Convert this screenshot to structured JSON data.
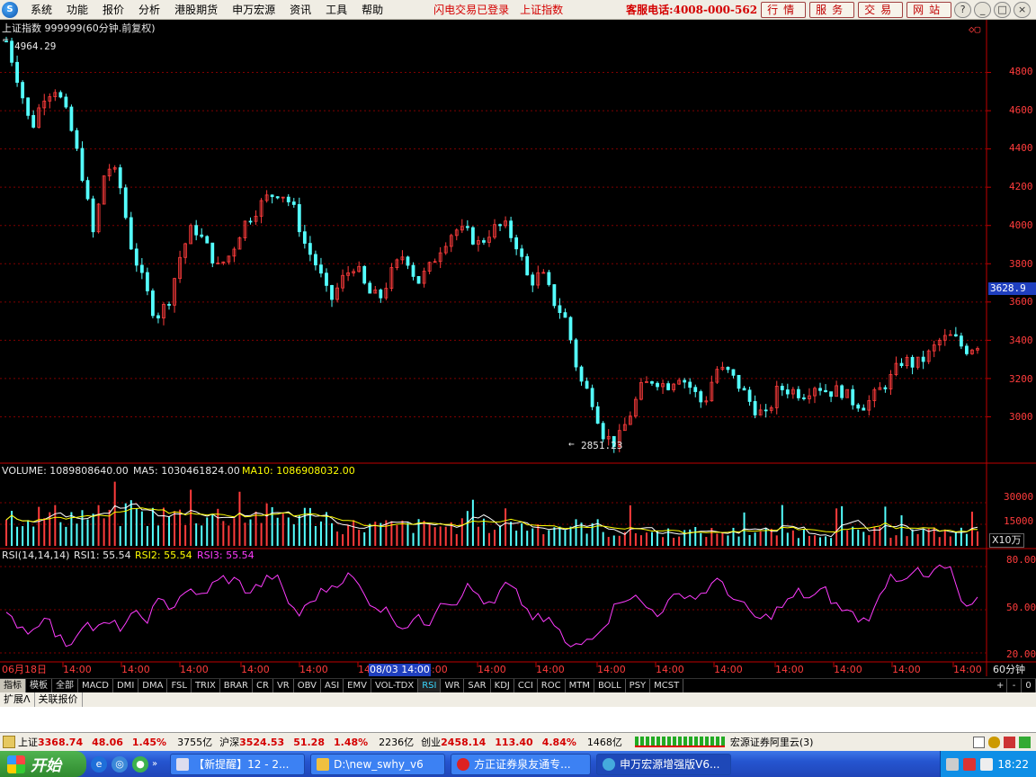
{
  "menu": {
    "app_icon": "globe-icon",
    "items": [
      "系统",
      "功能",
      "报价",
      "分析",
      "港股期货",
      "申万宏源",
      "资讯",
      "工具",
      "帮助"
    ],
    "flash_status": "闪电交易已登录",
    "index_name": "上证指数",
    "hotline": "客服电话:4008-000-562",
    "right_buttons": [
      "行情",
      "服务",
      "交易",
      "网站"
    ],
    "window_controls": [
      "?",
      "_",
      "□",
      "×"
    ]
  },
  "chart": {
    "header": "上证指数 999999(60分钟.前复权)",
    "high_label": "4964.29",
    "low_label": "2851.23",
    "current_price": "3628.9",
    "y_ticks": [
      "4800",
      "4600",
      "4400",
      "4200",
      "4000",
      "3800",
      "3600",
      "3400",
      "3200",
      "3000"
    ],
    "volume_header": {
      "volume": "VOLUME: 1089808640.00",
      "ma5": "MA5: 1030461824.00",
      "ma10": "MA10: 1086908032.00"
    },
    "volume_ticks": [
      "30000",
      "15000"
    ],
    "volume_unit": "X10万",
    "rsi_header": {
      "name": "RSI(14,14,14)",
      "rsi1": "RSI1: 55.54",
      "rsi2": "RSI2: 55.54",
      "rsi3": "RSI3: 55.54"
    },
    "rsi_ticks": [
      "80.00",
      "50.00",
      "20.00"
    ],
    "time_labels": [
      "06月18日",
      "14:00",
      "14:00",
      "14:00",
      "14:00",
      "14:00",
      "14:00",
      "14:00",
      "14:00",
      "14:00",
      "14:00",
      "14:00",
      "14:00",
      "14:00",
      "14:00",
      "14:00",
      "14:00"
    ],
    "cursor_label": "08/03 14:00",
    "period": "60分钟",
    "colors": {
      "up": "#ff3c3c",
      "down": "#54ffff",
      "ma5": "#ffffff",
      "ma10": "#ffff00",
      "rsi": "#ff3cff",
      "grid": "#800000",
      "axis": "#c00000"
    }
  },
  "chart_data": {
    "type": "candlestick",
    "title": "上证指数 999999(60分钟.前复权)",
    "ylim": [
      2800,
      5000
    ],
    "high": 4964.29,
    "low": 2851.23,
    "current": 3628.9,
    "price_path": [
      4964,
      4750,
      4500,
      4680,
      4720,
      4550,
      4300,
      3950,
      4320,
      4250,
      3900,
      3700,
      3520,
      3600,
      3850,
      4000,
      3900,
      3780,
      3850,
      4000,
      4080,
      4150,
      4180,
      4100,
      3900,
      3780,
      3600,
      3720,
      3800,
      3650,
      3620,
      3760,
      3860,
      3700,
      3780,
      3900,
      3980,
      3960,
      3900,
      3980,
      4000,
      3900,
      3700,
      3750,
      3600,
      3500,
      3200,
      3100,
      2900,
      2860,
      3000,
      3150,
      3200,
      3160,
      3220,
      3150,
      3060,
      3250,
      3230,
      3150,
      3050,
      3000,
      3150,
      3140,
      3120,
      3170,
      3130,
      3140,
      3080,
      3060,
      3130,
      3200,
      3300,
      3270,
      3320,
      3400,
      3420,
      3350,
      3380
    ],
    "volume_ylim": [
      0,
      40000
    ],
    "volume_ticks": [
      30000,
      15000
    ],
    "rsi_ylim": [
      15,
      85
    ],
    "rsi_ticks": [
      80,
      50,
      20
    ],
    "rsi_path": [
      45,
      40,
      34,
      48,
      30,
      26,
      42,
      36,
      40,
      38,
      46,
      44,
      56,
      52,
      64,
      58,
      66,
      72,
      70,
      62,
      68,
      75,
      56,
      46,
      58,
      64,
      70,
      74,
      60,
      52,
      48,
      38,
      44,
      40,
      58,
      54,
      66,
      60,
      50,
      68,
      60,
      46,
      42,
      40,
      22,
      26,
      34,
      42,
      58,
      60,
      52,
      48,
      56,
      62,
      58,
      66,
      70,
      56,
      50,
      42,
      48,
      54,
      62,
      58,
      64,
      52,
      48,
      42,
      50,
      74,
      72,
      78,
      70,
      80,
      76,
      48,
      55
    ]
  },
  "indicator_tabs": [
    "指标",
    "模板",
    "全部",
    "MACD",
    "DMI",
    "DMA",
    "FSL",
    "TRIX",
    "BRAR",
    "CR",
    "VR",
    "OBV",
    "ASI",
    "EMV",
    "VOL-TDX",
    "RSI",
    "WR",
    "SAR",
    "KDJ",
    "CCI",
    "ROC",
    "MTM",
    "BOLL",
    "PSY",
    "MCST"
  ],
  "active_tab": "RSI",
  "sub_tabs": [
    "扩展Λ",
    "关联报价"
  ],
  "right_controls": [
    "+",
    "-",
    "0"
  ],
  "statusbar": {
    "sh_label": "上证",
    "sh_price": "3368.74",
    "sh_change": "48.06",
    "sh_pct": "1.45%",
    "sh_amount": "3755亿",
    "hs_label": "沪深",
    "hs_price": "3524.53",
    "hs_change": "51.28",
    "hs_pct": "1.48%",
    "hs_amount": "2236亿",
    "cy_label": "创业",
    "cy_price": "2458.14",
    "cy_change": "113.40",
    "cy_pct": "4.84%",
    "cy_amount": "1468亿",
    "broker": "宏源证券阿里云(3)"
  },
  "taskbar": {
    "start_label": "开始",
    "quick_launch": [
      "ie-icon",
      "browser-icon",
      "green-circle-icon"
    ],
    "tasks": [
      "【新提醒】12 - 2...",
      "D:\\new_swhy_v6",
      "方正证券泉友通专...",
      "申万宏源增强版V6..."
    ],
    "active_task": 3,
    "time": "18:22"
  }
}
